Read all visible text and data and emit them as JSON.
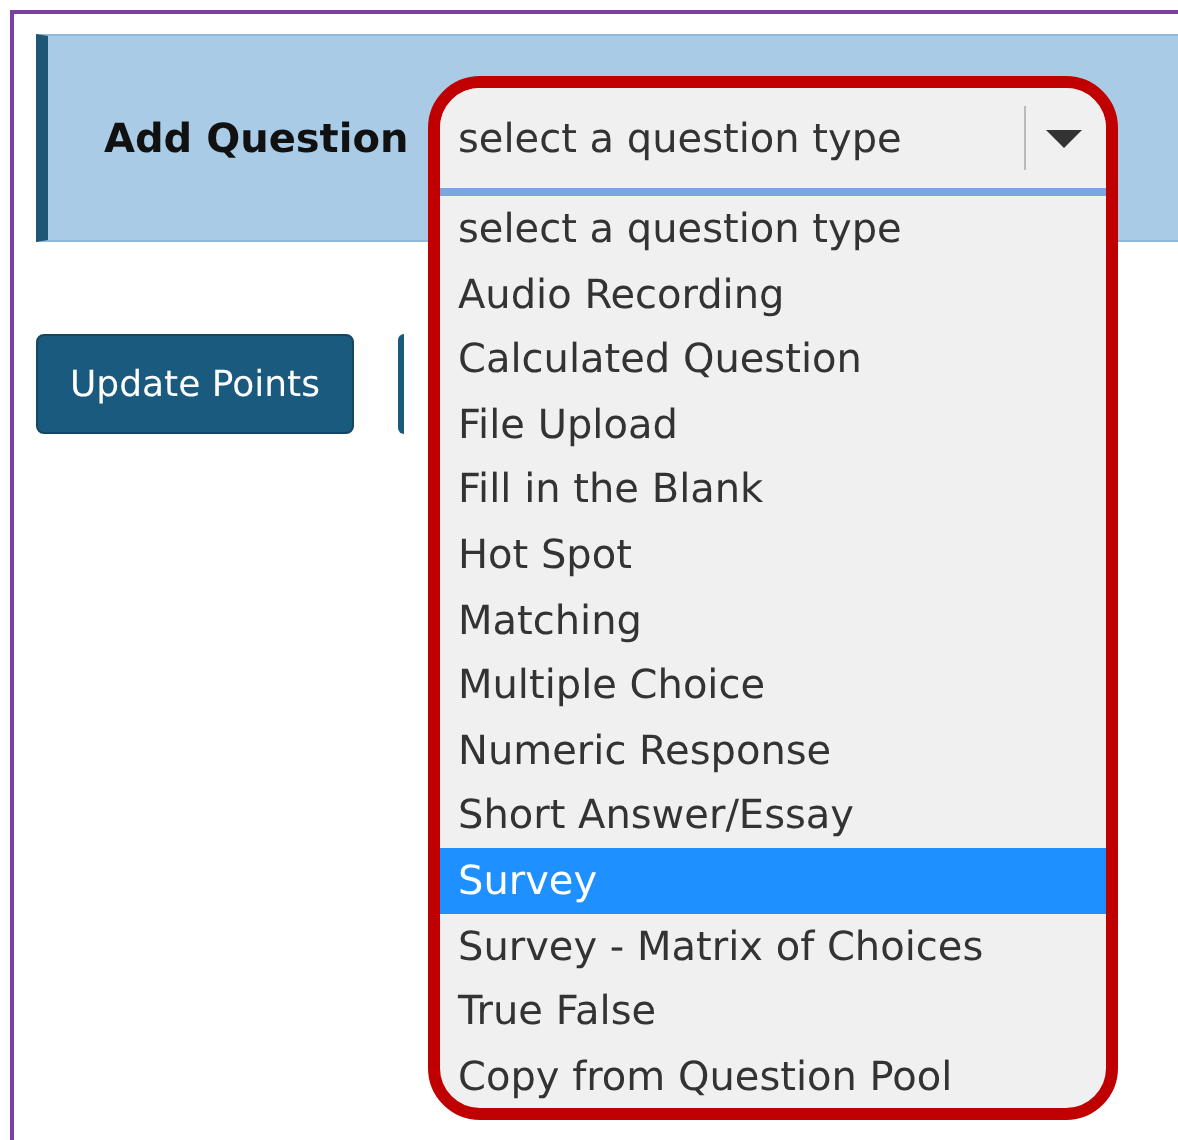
{
  "header": {
    "title": "Add Question",
    "select": {
      "value": "select a question type",
      "expanded": true
    }
  },
  "buttons": [
    {
      "label": "Update Points"
    }
  ],
  "dropdown": {
    "options": [
      {
        "label": "select a question type",
        "selected": false
      },
      {
        "label": "Audio Recording",
        "selected": false
      },
      {
        "label": "Calculated Question",
        "selected": false
      },
      {
        "label": "File Upload",
        "selected": false
      },
      {
        "label": "Fill in the Blank",
        "selected": false
      },
      {
        "label": "Hot Spot",
        "selected": false
      },
      {
        "label": "Matching",
        "selected": false
      },
      {
        "label": "Multiple Choice",
        "selected": false
      },
      {
        "label": "Numeric Response",
        "selected": false
      },
      {
        "label": "Short Answer/Essay",
        "selected": false
      },
      {
        "label": "Survey",
        "selected": true
      },
      {
        "label": "Survey - Matrix of Choices",
        "selected": false
      },
      {
        "label": "True False",
        "selected": false
      },
      {
        "label": "Copy from Question Pool",
        "selected": false
      }
    ]
  }
}
